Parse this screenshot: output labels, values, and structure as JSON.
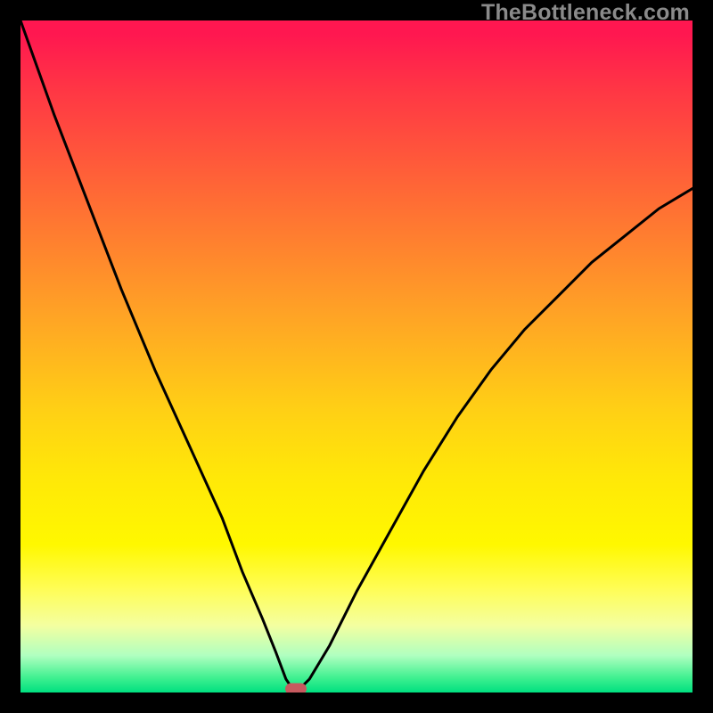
{
  "watermark": "TheBottleneck.com",
  "chart_data": {
    "type": "line",
    "title": "",
    "xlabel": "",
    "ylabel": "",
    "xlim": [
      0,
      100
    ],
    "ylim": [
      0,
      100
    ],
    "grid": false,
    "legend": false,
    "series": [
      {
        "name": "bottleneck-curve",
        "x": [
          0,
          5,
          10,
          15,
          20,
          25,
          30,
          33,
          36,
          38,
          39.5,
          40.5,
          41.5,
          43,
          46,
          50,
          55,
          60,
          65,
          70,
          75,
          80,
          85,
          90,
          95,
          100
        ],
        "values": [
          100,
          86,
          73,
          60,
          48,
          37,
          26,
          18,
          11,
          6,
          2,
          0.5,
          0.5,
          2,
          7,
          15,
          24,
          33,
          41,
          48,
          54,
          59,
          64,
          68,
          72,
          75
        ]
      }
    ],
    "marker": {
      "x": 41.0,
      "y": 0.5
    },
    "background_gradient": {
      "top": "#ff1750",
      "mid": "#ffe000",
      "bottom": "#00e080"
    },
    "frame_color": "#000000",
    "curve_color": "#000000",
    "marker_color": "#c75a5f"
  }
}
